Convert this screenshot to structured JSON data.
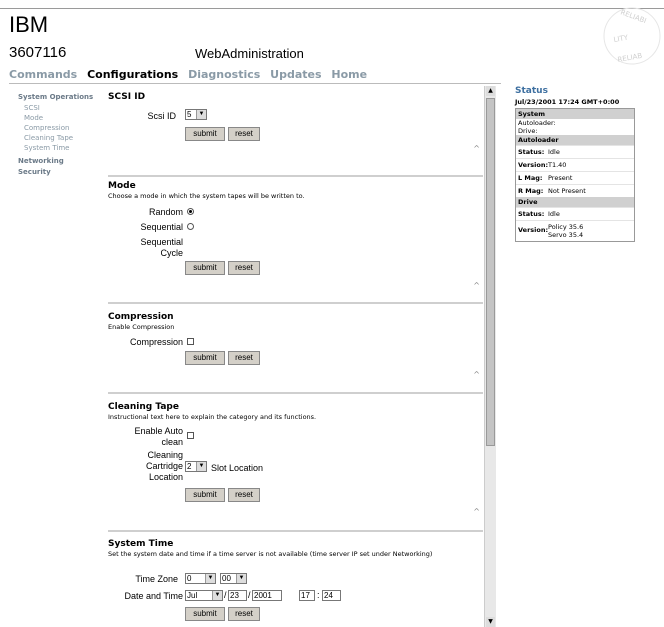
{
  "header": {
    "brand": "IBM",
    "model": "3607116",
    "app_title": "WebAdministration",
    "seal_text": "RELIABILITY"
  },
  "nav": {
    "tabs": [
      "Commands",
      "Configurations",
      "Diagnostics",
      "Updates",
      "Home"
    ],
    "active": "Configurations"
  },
  "sidebar": {
    "group1": "System Operations",
    "items": [
      "SCSI",
      "Mode",
      "Compression",
      "Cleaning Tape",
      "System Time"
    ],
    "networking": "Networking",
    "security": "Security"
  },
  "scsi": {
    "title": "SCSI ID",
    "label": "Scsi ID",
    "value": "5"
  },
  "mode": {
    "title": "Mode",
    "desc": "Choose a mode in which the system tapes will be written to.",
    "random": "Random",
    "sequential": "Sequential",
    "sequential_cycle_1": "Sequential",
    "sequential_cycle_2": "Cycle",
    "selected": "Random"
  },
  "compression": {
    "title": "Compression",
    "desc": "Enable Compression",
    "label": "Compression"
  },
  "cleaning": {
    "title": "Cleaning Tape",
    "desc": "Instructional text here to explain the category and its functions.",
    "auto_1": "Enable Auto",
    "auto_2": "clean",
    "cart_1": "Cleaning",
    "cart_2": "Cartridge",
    "cart_3": "Location",
    "cart_value": "2",
    "slot_label": "Slot Location"
  },
  "systime": {
    "title": "System Time",
    "desc": "Set the system date and time if a time server is not available (time server IP set under Networking)",
    "tz_label": "Time Zone",
    "tz_hours": "0",
    "tz_mins": "00",
    "dt_label": "Date and Time",
    "month": "Jul",
    "day": "23",
    "year": "2001",
    "hour": "17",
    "minute": "24"
  },
  "buttons": {
    "submit": "submit",
    "reset": "reset"
  },
  "status": {
    "title": "Status",
    "timestamp": "Jul/23/2001 17:24 GMT+0:00",
    "system_head": "System",
    "autoloader_line": "Autoloader:",
    "drive_line": "Drive:",
    "autoloader_head": "Autoloader",
    "al_status_k": "Status:",
    "al_status_v": "Idle",
    "al_version_k": "Version:",
    "al_version_v": "T1.40",
    "lmag_k": "L Mag:",
    "lmag_v": "Present",
    "rmag_k": "R Mag:",
    "rmag_v": "Not Present",
    "drive_head": "Drive",
    "dr_status_k": "Status:",
    "dr_status_v": "Idle",
    "dr_version_k": "Version:",
    "dr_version_v1": "Policy 35.6",
    "dr_version_v2": "Servo 35.4"
  }
}
